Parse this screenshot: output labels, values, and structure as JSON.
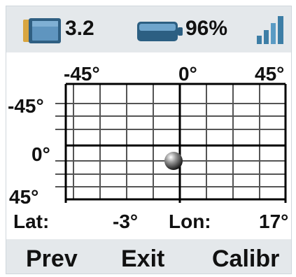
{
  "status": {
    "device_icon": "display-device-icon",
    "device_value": "3.2",
    "battery_icon": "battery-icon",
    "battery_level": 0.96,
    "battery_text": "96%",
    "signal_icon": "signal-strength-icon",
    "signal_bars_filled": 4,
    "signal_bars_total": 4
  },
  "grid": {
    "top_labels": [
      "-45°",
      "0°",
      "45°"
    ],
    "side_labels": [
      "-45°",
      "0°",
      "45°"
    ],
    "ball_icon": "level-ball-icon"
  },
  "readout": {
    "lat_label": "Lat:",
    "lat_value": "-3°",
    "lon_label": "Lon:",
    "lon_value": "17°"
  },
  "softkeys": {
    "prev": "Prev",
    "exit": "Exit",
    "calibrate": "Calibr"
  },
  "colors": {
    "bar_background": "#e4e8eb",
    "signal": "#3d7ea6",
    "battery": "#356f96",
    "device_body": "#4a7fa8",
    "device_edge": "#d9a640"
  }
}
